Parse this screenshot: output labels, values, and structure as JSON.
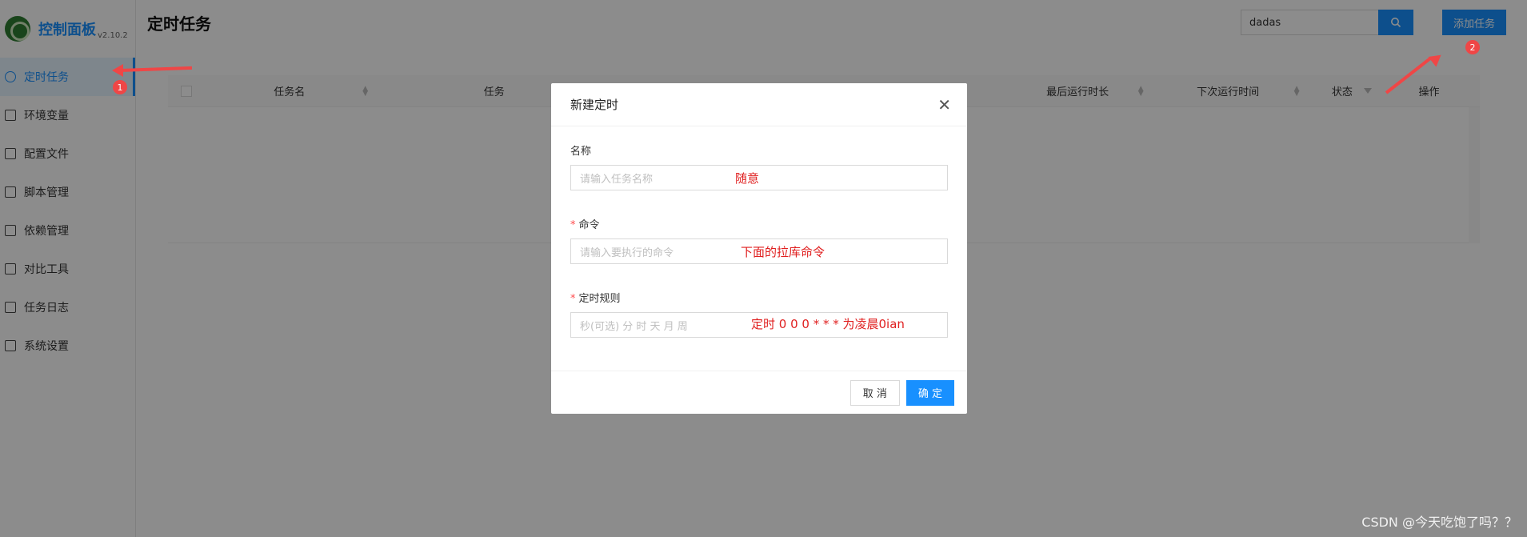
{
  "sidebar": {
    "logo_title": "控制面板",
    "logo_version": "v2.10.2",
    "items": [
      {
        "label": "定时任务",
        "icon": "clock-icon"
      },
      {
        "label": "环境变量",
        "icon": "env-icon"
      },
      {
        "label": "配置文件",
        "icon": "config-icon"
      },
      {
        "label": "脚本管理",
        "icon": "edit-icon"
      },
      {
        "label": "依赖管理",
        "icon": "dependency-icon"
      },
      {
        "label": "对比工具",
        "icon": "diff-icon"
      },
      {
        "label": "任务日志",
        "icon": "folder-icon"
      },
      {
        "label": "系统设置",
        "icon": "settings-icon"
      }
    ],
    "active_index": 0
  },
  "header": {
    "title": "定时任务",
    "search_value": "dadas",
    "add_button": "添加任务"
  },
  "table": {
    "columns": [
      "任务名",
      "任务",
      "最后运行时长",
      "下次运行时间",
      "状态",
      "操作"
    ]
  },
  "modal": {
    "title": "新建定时",
    "fields": [
      {
        "label": "名称",
        "required": false,
        "placeholder": "请输入任务名称",
        "note": "随意"
      },
      {
        "label": "命令",
        "required": true,
        "placeholder": "请输入要执行的命令",
        "note": "下面的拉库命令"
      },
      {
        "label": "定时规则",
        "required": true,
        "placeholder": "秒(可选) 分 时 天 月 周",
        "note": "定时 0 0 0 * * * 为凌晨0ian"
      }
    ],
    "cancel": "取 消",
    "ok": "确 定"
  },
  "annotations": {
    "badge1": "1",
    "badge2": "2"
  },
  "watermark": "CSDN @今天吃饱了吗？？",
  "colors": {
    "primary": "#1890ff",
    "annotation": "#ef4646",
    "required": "#ff4d4f"
  }
}
